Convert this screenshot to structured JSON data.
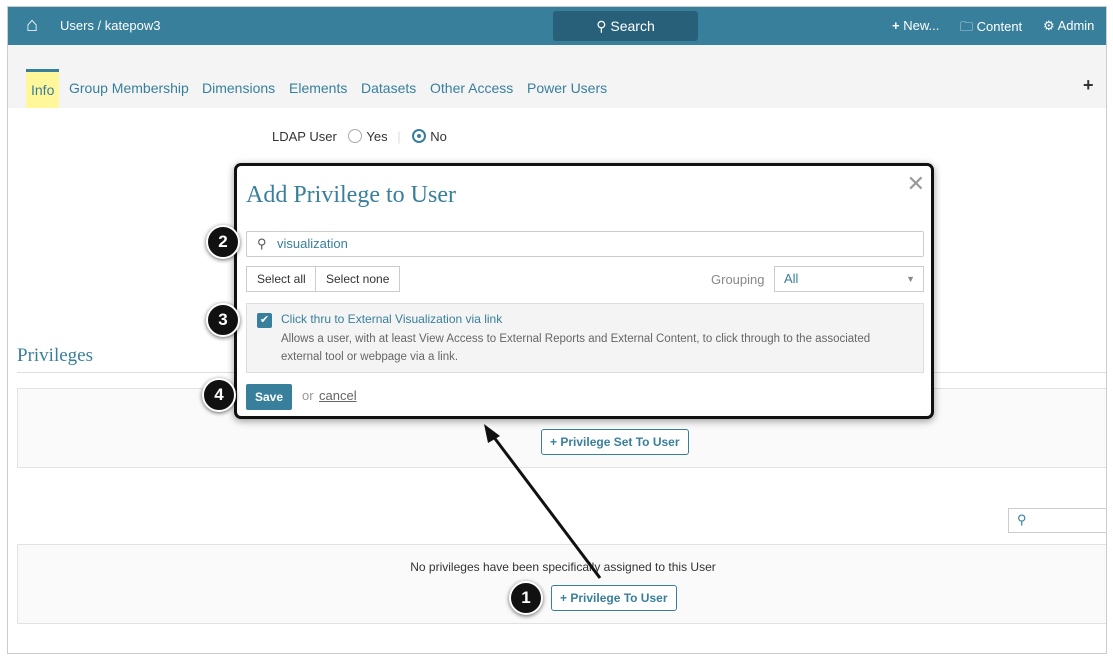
{
  "header": {
    "breadcrumb": "Users / katepow3",
    "search": "Search",
    "new": "New...",
    "content": "Content",
    "admin": "Admin"
  },
  "tabs": [
    "Info",
    "Group Membership",
    "Dimensions",
    "Elements",
    "Datasets",
    "Other Access",
    "Power Users"
  ],
  "ldap": {
    "label": "LDAP User",
    "yes": "Yes",
    "no": "No",
    "selected": "No"
  },
  "privileges": {
    "heading": "Privileges",
    "set_button": "Privilege Set To User",
    "empty": "No privileges have been specifically assigned to this User",
    "add_button": "Privilege To User"
  },
  "modal": {
    "title": "Add Privilege to User",
    "search_value": "visualization",
    "select_all": "Select all",
    "select_none": "Select none",
    "grouping_label": "Grouping",
    "grouping_value": "All",
    "item": {
      "title": "Click thru to External Visualization via link",
      "description": "Allows a user, with at least View Access to External Reports and External Content, to click through to the associated external tool or webpage via a link.",
      "checked": true
    },
    "save": "Save",
    "or": "or",
    "cancel": "cancel"
  },
  "badges": [
    "1",
    "2",
    "3",
    "4"
  ]
}
